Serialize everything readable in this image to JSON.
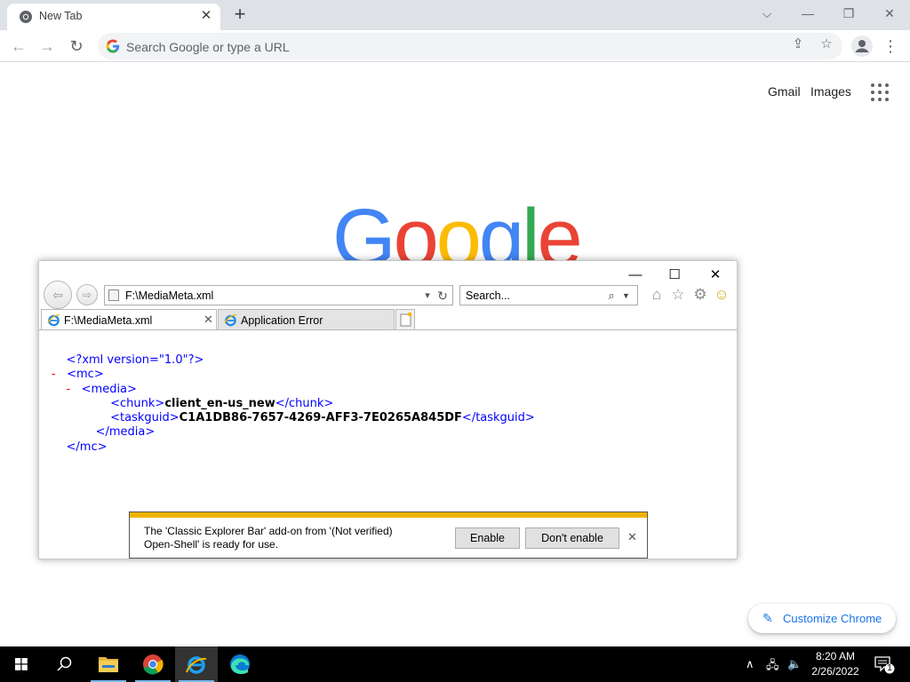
{
  "chrome": {
    "tab_title": "New Tab",
    "tab_close": "✕",
    "new_tab": "+",
    "window_controls": {
      "dropdown": "⌵",
      "minimize": "—",
      "restore": "❐",
      "close": "✕"
    },
    "omnibox_placeholder": "Search Google or type a URL",
    "menu": "⋮"
  },
  "ntp": {
    "gmail": "Gmail",
    "images": "Images",
    "logo": "Google",
    "customize": "Customize Chrome"
  },
  "ie": {
    "address": "F:\\MediaMeta.xml",
    "search_placeholder": "Search...",
    "tabs": [
      {
        "label": "F:\\MediaMeta.xml",
        "active": true
      },
      {
        "label": "Application Error",
        "active": false
      }
    ],
    "xml": {
      "decl": "<?xml version=\"1.0\"?>",
      "root_open": "<mc>",
      "media_open": "<media>",
      "chunk_tag_open": "<chunk>",
      "chunk_value": "client_en-us_new",
      "chunk_tag_close": "</chunk>",
      "taskguid_tag_open": "<taskguid>",
      "taskguid_value": "C1A1DB86-7657-4269-AFF3-7E0265A845DF",
      "taskguid_tag_close": "</taskguid>",
      "media_close": "</media>",
      "root_close": "</mc>",
      "collapse_marker": "-"
    },
    "notification": {
      "line1": "The 'Classic Explorer Bar' add-on from '(Not verified)",
      "line2": "Open-Shell' is ready for use.",
      "enable": "Enable",
      "dont_enable": "Don't enable",
      "close": "✕"
    }
  },
  "taskbar": {
    "time": "8:20 AM",
    "date": "2/26/2022",
    "notification_count": "1"
  },
  "colors": {
    "google_blue": "#4285f4",
    "google_red": "#ea4335",
    "google_yellow": "#fbbc05",
    "google_green": "#34a853",
    "notify_bar": "#f0b400"
  }
}
